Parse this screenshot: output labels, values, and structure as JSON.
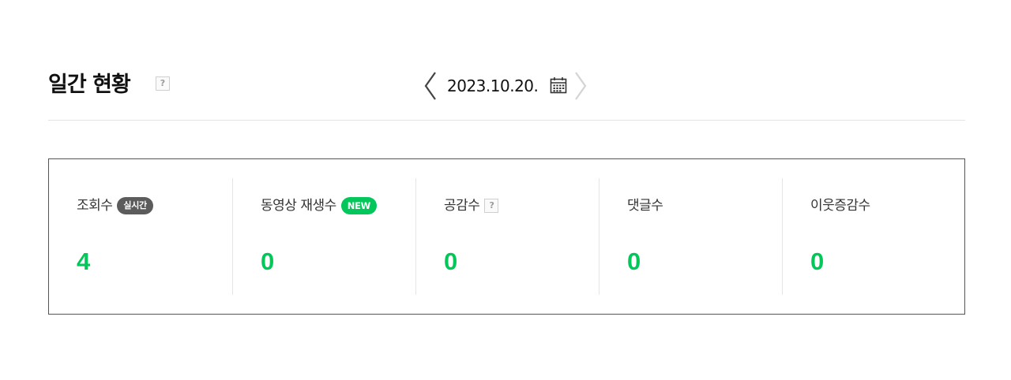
{
  "header": {
    "title": "일간 현황",
    "help_label": "?",
    "date": "2023.10.20."
  },
  "stats": [
    {
      "label": "조회수",
      "badge": "실시간",
      "value": "4"
    },
    {
      "label": "동영상 재생수",
      "badge": "NEW",
      "value": "0"
    },
    {
      "label": "공감수",
      "help_label": "?",
      "value": "0"
    },
    {
      "label": "댓글수",
      "value": "0"
    },
    {
      "label": "이웃증감수",
      "value": "0"
    }
  ],
  "colors": {
    "accent_green": "#03c75a",
    "badge_dark": "#5c5c5c",
    "border": "#555555"
  },
  "icons": {
    "prev": "chevron-left-icon",
    "next": "chevron-right-icon",
    "calendar": "calendar-icon",
    "help": "help-icon"
  }
}
